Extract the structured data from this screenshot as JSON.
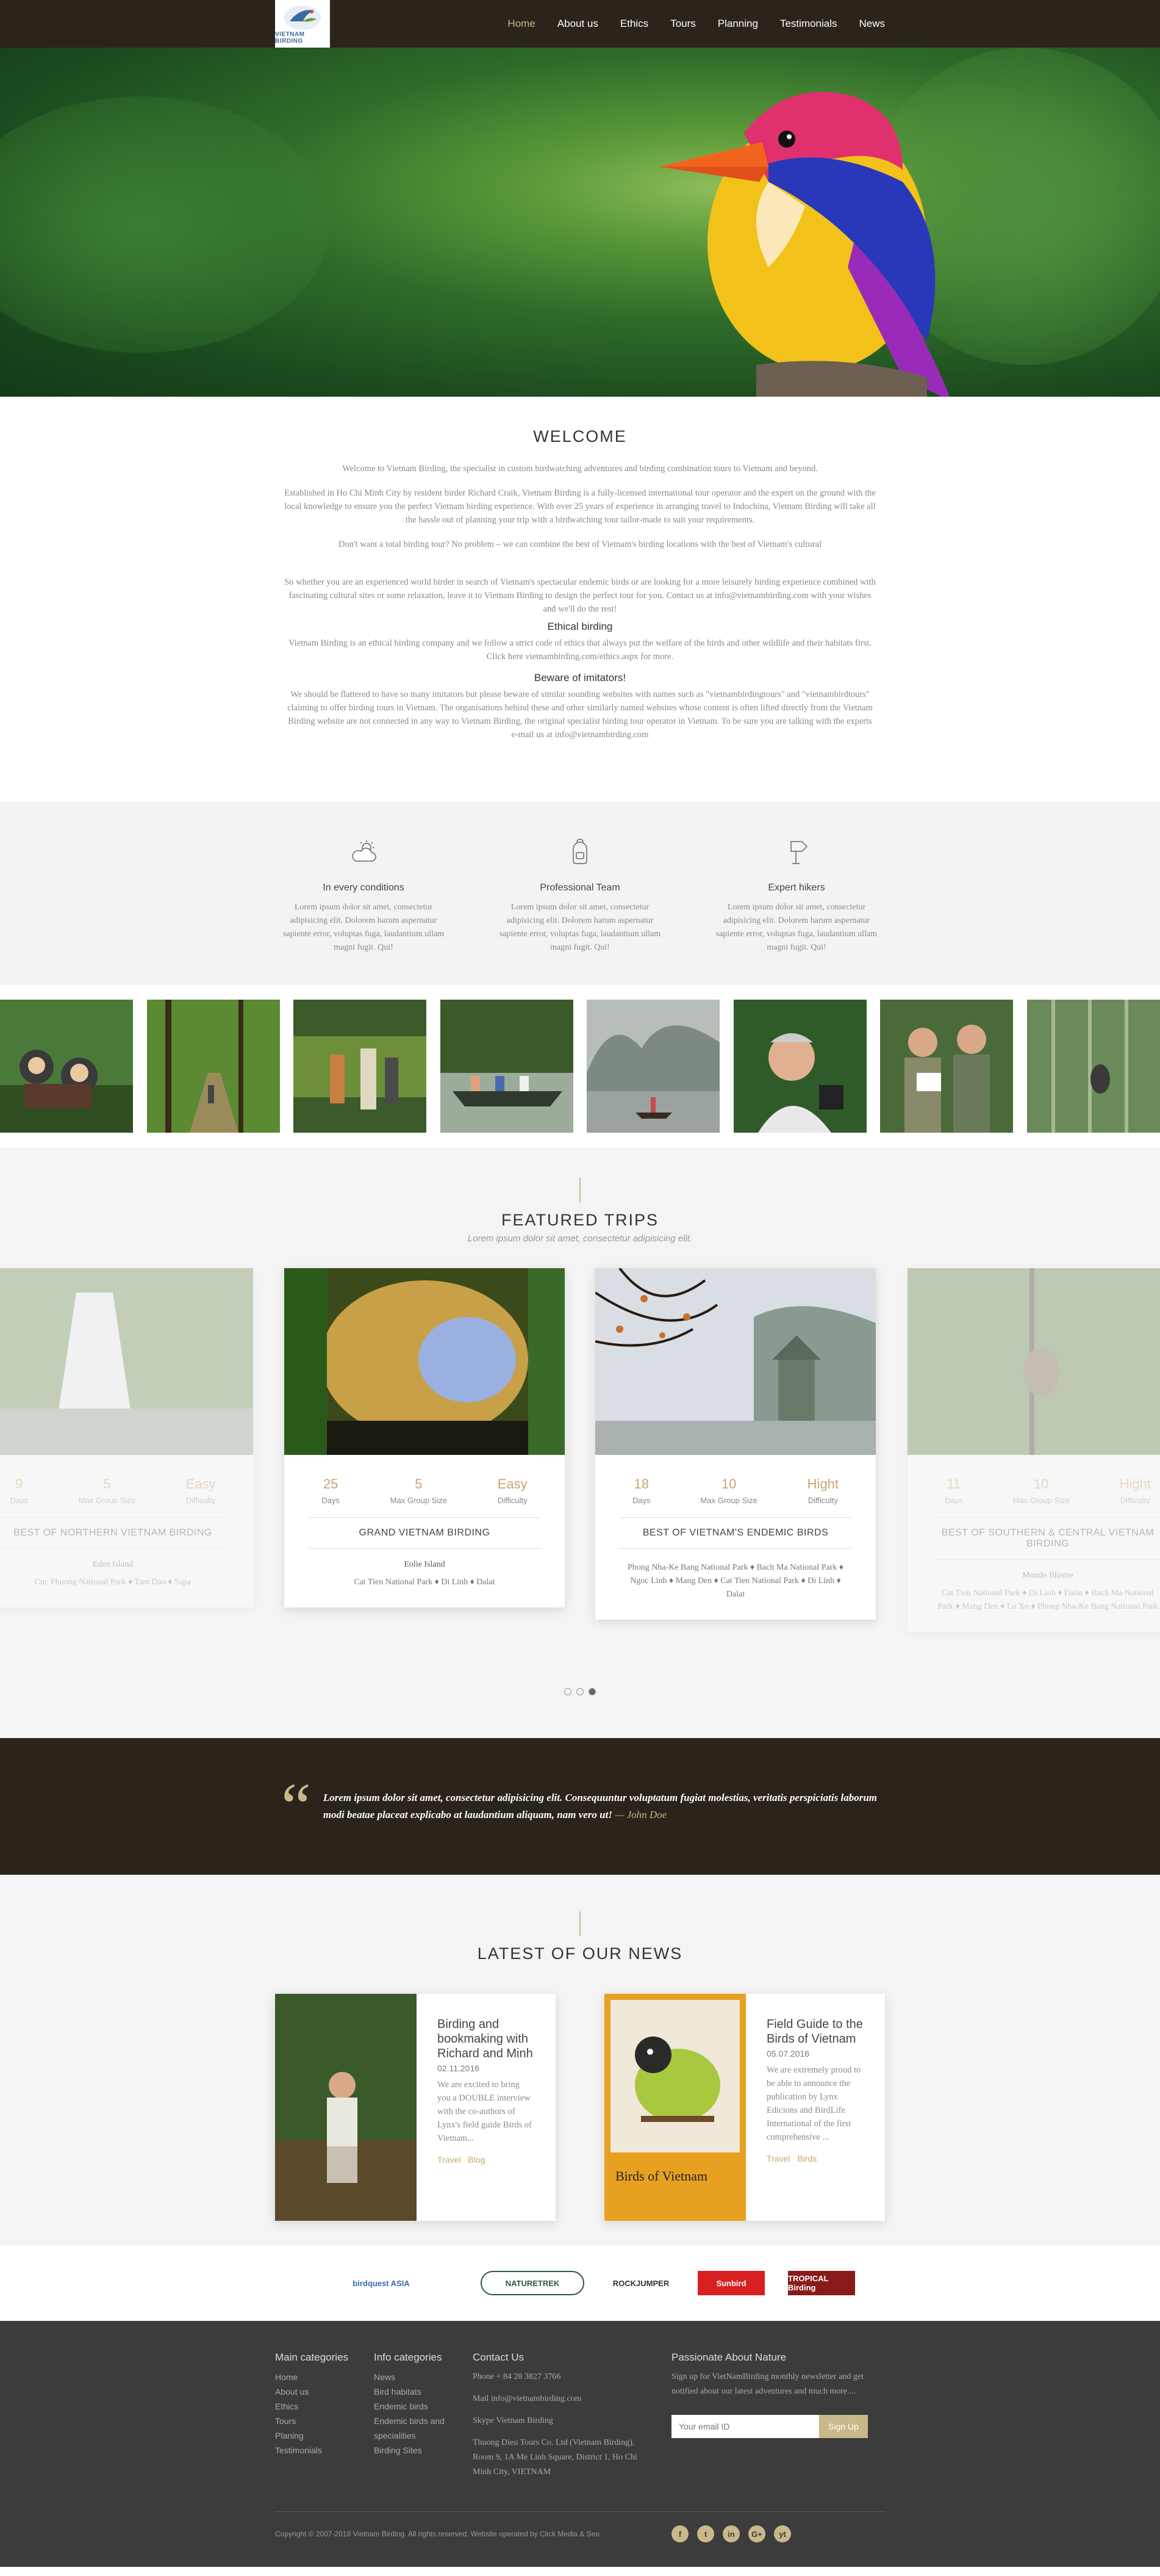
{
  "brand": {
    "logo_text": "VIETNAM BIRDING"
  },
  "nav": [
    "Home",
    "About us",
    "Ethics",
    "Tours",
    "Planning",
    "Testimonials",
    "News"
  ],
  "welcome": {
    "title": "WELCOME",
    "p1": "Welcome to Vietnam Birding, the specialist in custom birdwatching adventures and birding combination tours to Vietnam and beyond.",
    "p2": "Established in Ho Chi Minh City by resident birder Richard Craik, Vietnam Birding is a fully-licensed international tour operator and the expert on the ground with the local knowledge to ensure you the perfect Vietnam birding experience. With over 25 years of experience in arranging travel to Indochina, Vietnam Birding will take all the hassle out of planning your trip with a birdwatching tour tailor-made to suit your requirements.",
    "p3": "Don't want a total birding tour? No problem – we can combine the best of Vietnam's birding locations with the best of Vietnam's cultural",
    "p4": "So whether you are an experienced world birder in search of Vietnam's spectacular endemic birds or are looking for a more leisurely birding experience combined with fascinating cultural sites or some relaxation, leave it to Vietnam Birding to design the perfect tour for you. Contact us at info@vietnambirding.com with your wishes and we'll do the rest!",
    "ethical_title": "Ethical birding",
    "ethical_text": "Vietnam Birding is an ethical birding company and we follow a strict code of ethics that always put the welfare of the birds and other wildlife and their habitats first. Click here vietnambirding.com/ethics.aspx for more.",
    "beware_title": "Beware of imitators!",
    "beware_text": "We should be flattered to have so many imitators but please beware of similar sounding websites with names such as \"vietnambirdingtours\" and \"vietnambirdtours\" claiming to offer birding tours in Vietnam. The organisations behind these and other similarly named websites whose content is often lifted directly from the Vietnam Birding website are not connected in any way to Vietnam Birding, the original specialist birding tour operator in Vietnam. To be sure you are talking with the experts e-mail us at info@vietnambirding.com"
  },
  "features": [
    {
      "icon": "cloud-sun-icon",
      "title": "In every conditions",
      "text": "Lorem ipsum dolor sit amet, consectetur adipisicing elit. Dolorem harum aspernatur sapiente error, voluptas fuga, laudantium ullam magni fugit. Qui!"
    },
    {
      "icon": "backpack-icon",
      "title": "Professional Team",
      "text": "Lorem ipsum dolor sit amet, consectetur adipisicing elit. Dolorem harum aspernatur sapiente error, voluptas fuga, laudantium ullam magni fugit. Qui!"
    },
    {
      "icon": "signpost-icon",
      "title": "Expert hikers",
      "text": "Lorem ipsum dolor sit amet, consectetur adipisicing elit. Dolorem harum aspernatur sapiente error, voluptas fuga, laudantium ullam magni fugit. Qui!"
    }
  ],
  "trips": {
    "title": "FEATURED TRIPS",
    "subtitle": "Lorem ipsum dolor sit amet, consectetur adipisicing elit.",
    "items": [
      {
        "days": "9",
        "group": "5",
        "difficulty": "Easy",
        "name": "BEST OF NORTHERN VIETNAM BIRDING",
        "place": "Eden Island",
        "route": "Cuc Phuong National Park ♦ Tam Dao ♦ Sapa"
      },
      {
        "days": "25",
        "group": "5",
        "difficulty": "Easy",
        "name": "GRAND VIETNAM BIRDING",
        "place": "Eolie Island",
        "route": "Cat Tien National Park ♦ Di Linh ♦ Dalat"
      },
      {
        "days": "18",
        "group": "10",
        "difficulty": "Hight",
        "name": "BEST OF VIETNAM'S ENDEMIC BIRDS",
        "place": "",
        "route": "Phong Nha-Ke Bang National Park ♦ Bach Ma National Park ♦ Ngoc Linh ♦ Mang Den ♦ Cat Tien National Park ♦ Di Linh ♦ Dalat"
      },
      {
        "days": "11",
        "group": "10",
        "difficulty": "Hight",
        "name": "BEST OF SOUTHERN & CENTRAL VIETNAM BIRDING",
        "place": "Mondo Illustre",
        "route": "Cat Tien National Park ♦ Di Linh ♦ Dalat ♦ Bach Ma National Park ♦ Mang Den ♦ Lo Xo ♦ Phong Nha-Ke Bang National Park"
      }
    ],
    "labels": {
      "days": "Days",
      "group": "Max Group Size",
      "difficulty": "Difficulty"
    }
  },
  "quote": {
    "text": "Lorem ipsum dolor sit amet, consectetur adipisicing elit. Consequuntur voluptatum fugiat molestias, veritatis perspiciatis laborum modi beatae placeat explicabo at laudantium aliquam, nam vero ut!",
    "author": "— John Doe"
  },
  "news": {
    "title": "LATEST OF OUR NEWS",
    "items": [
      {
        "title": "Birding and bookmaking with Richard and Minh",
        "date": "02.11.2016",
        "excerpt": "We are excited to bring you a DOUBLE interview with the co-authors of Lynx's field guide Birds of Vietnam...",
        "tags": [
          "Travel",
          "Blog"
        ]
      },
      {
        "title": "Field Guide to the Birds of Vietnam",
        "date": "05.07.2016",
        "excerpt": "We are extremely proud to be able to announce the publication by Lynx Edicions and BirdLife International of the first comprehensive ...",
        "tags": [
          "Travel",
          "Birds"
        ]
      }
    ],
    "book_title": "Birds of Vietnam"
  },
  "partners": [
    "birdquest ASIA",
    "NATURETREK",
    "ROCKJUMPER",
    "Sunbird",
    "TROPICAL Birding"
  ],
  "footer": {
    "main_title": "Main categories",
    "main": [
      "Home",
      "About us",
      "Ethics",
      "Tours",
      "Planing",
      "Testimonials"
    ],
    "info_title": "Info categories",
    "info": [
      "News",
      "Bird habitats",
      "Endemic birds",
      "Endemic birds and specialities",
      "Birding Sites"
    ],
    "contact_title": "Contact Us",
    "phone": "Phone + 84 28 3827 3766",
    "mail": "Mail info@vietnambirding.com",
    "skype": "Skype Vietnam Birding",
    "address": "Thuong Dieu Tours Co. Ltd (Vietnam Birding), Room 9, 1A Me Linh Square, District 1, Ho Chi Minh City, VIETNAM",
    "newsletter_title": "Passionate About Nature",
    "newsletter_text": "Sign up for VietNamBirding monthly newsletter and get notified about our latest adventures and much more....",
    "email_placeholder": "Your email ID",
    "signup": "Sign Up",
    "copyright": "Copyright © 2007-2018 Vietnam Birding. All rights reserved. Website operated by Click Media & Seo",
    "social": [
      "f",
      "t",
      "in",
      "G+",
      "yt"
    ]
  },
  "colors": {
    "dark": "#2a241b",
    "accent": "#c9b88a",
    "footer": "#3c3c3c"
  }
}
